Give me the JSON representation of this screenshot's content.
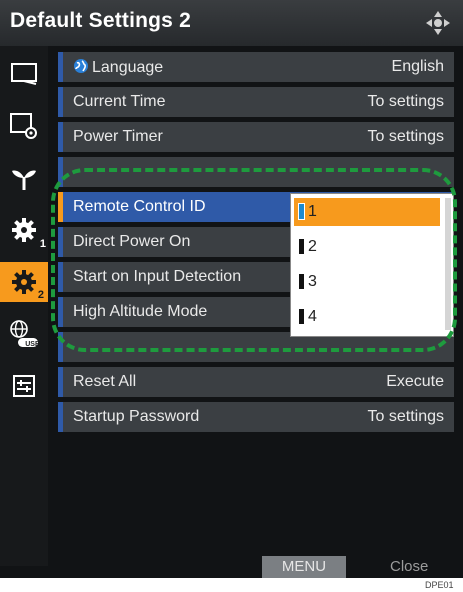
{
  "window": {
    "title": "Default Settings 2"
  },
  "colors": {
    "accent": "#f79a1d",
    "selected": "#2f5aa8",
    "highlight_frame": "#1e9b3e",
    "row_bg": "#3b3f43"
  },
  "sidebar": {
    "items": [
      {
        "icon": "display-icon"
      },
      {
        "icon": "display-settings-icon"
      },
      {
        "icon": "eco-plant-icon"
      },
      {
        "icon": "gear-icon",
        "sub": "1"
      },
      {
        "icon": "gear-icon",
        "sub": "2",
        "active": true
      },
      {
        "icon": "network-usb-icon",
        "sub": "USB"
      },
      {
        "icon": "control-panel-icon"
      }
    ]
  },
  "settings": {
    "rows": [
      {
        "label": "Language",
        "value": "English"
      },
      {
        "label": "Current Time",
        "value": "To settings"
      },
      {
        "label": "Power Timer",
        "value": "To settings"
      },
      {
        "label": "",
        "value": ""
      },
      {
        "label": "Remote Control ID",
        "value": ""
      },
      {
        "label": "Direct Power On",
        "value": ""
      },
      {
        "label": "Start on Input Detection",
        "value": ""
      },
      {
        "label": "High Altitude Mode",
        "value": ""
      },
      {
        "label": "",
        "value": ""
      },
      {
        "label": "Reset All",
        "value": "Execute"
      },
      {
        "label": "Startup Password",
        "value": "To settings"
      }
    ]
  },
  "dropdown": {
    "options": [
      "1",
      "2",
      "3",
      "4"
    ],
    "selected": "1"
  },
  "footer": {
    "menu": "MENU",
    "close": "Close"
  },
  "figure_code": "DPE01"
}
